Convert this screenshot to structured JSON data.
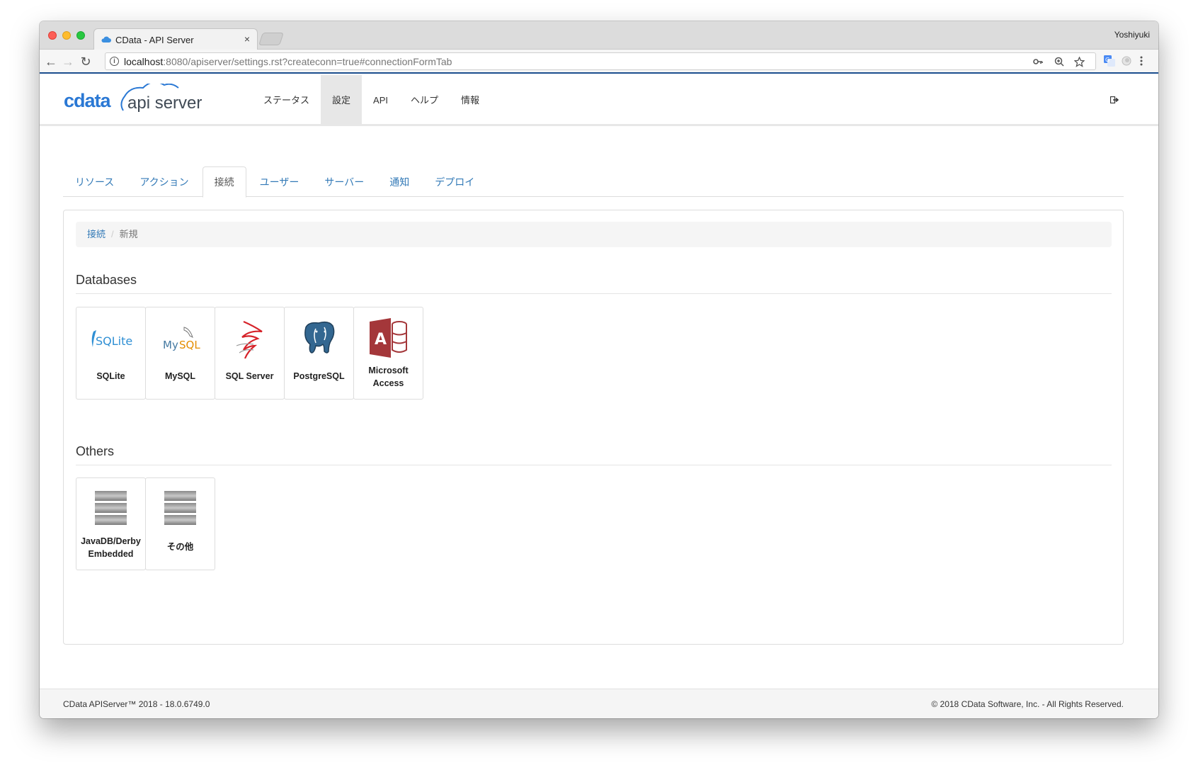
{
  "browser": {
    "tab_title": "CData - API Server",
    "tab_close": "×",
    "user_name": "Yoshiyuki",
    "url_host": "localhost",
    "url_rest": ":8080/apiserver/settings.rst?createconn=true#connectionFormTab",
    "nav_back": "←",
    "nav_forward": "→",
    "nav_reload": "↻"
  },
  "app": {
    "logo_text": "cdata",
    "logo_product": "api server",
    "topnav": [
      {
        "label": "ステータス"
      },
      {
        "label": "設定",
        "active": true
      },
      {
        "label": "API"
      },
      {
        "label": "ヘルプ"
      },
      {
        "label": "情報"
      }
    ]
  },
  "tabs": [
    {
      "label": "リソース"
    },
    {
      "label": "アクション"
    },
    {
      "label": "接続",
      "active": true
    },
    {
      "label": "ユーザー"
    },
    {
      "label": "サーバー"
    },
    {
      "label": "通知"
    },
    {
      "label": "デプロイ"
    }
  ],
  "breadcrumb": {
    "link": "接続",
    "separator": "/",
    "current": "新規"
  },
  "sections": {
    "databases": {
      "title": "Databases",
      "cards": [
        {
          "label": "SQLite",
          "icon": "sqlite-icon"
        },
        {
          "label": "MySQL",
          "icon": "mysql-icon"
        },
        {
          "label": "SQL Server",
          "icon": "sql-server-icon"
        },
        {
          "label": "PostgreSQL",
          "icon": "postgresql-icon"
        },
        {
          "label_line1": "Microsoft",
          "label_line2": "Access",
          "icon": "microsoft-access-icon"
        }
      ]
    },
    "others": {
      "title": "Others",
      "cards": [
        {
          "label_line1": "JavaDB/Derby",
          "label_line2": "Embedded",
          "icon": "database-icon"
        },
        {
          "label": "その他",
          "icon": "database-icon"
        }
      ]
    }
  },
  "icon_text": {
    "sqlite": "SQLite",
    "mysql_my": "My",
    "mysql_sql": "SQL",
    "access_letter": "A"
  },
  "footer": {
    "left": "CData APIServer™ 2018 - 18.0.6749.0",
    "right": "© 2018 CData Software, Inc. - All Rights Reserved."
  },
  "colors": {
    "accent": "#337ab7",
    "logo_blue": "#2a78d4",
    "access_red": "#a4373a",
    "sql_server_red": "#d6232a",
    "mysql_orange": "#e48e00",
    "postgres_blue": "#336791"
  }
}
